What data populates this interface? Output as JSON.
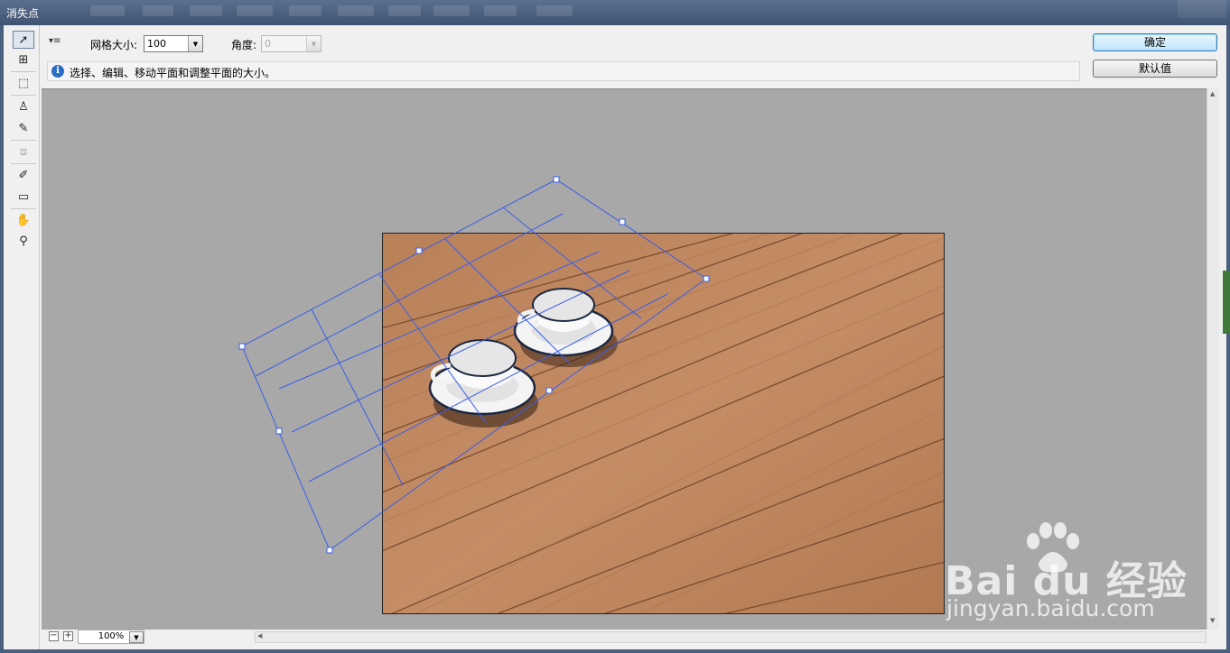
{
  "window": {
    "title": "消失点"
  },
  "tools": [
    {
      "name": "edit-plane-tool-icon",
      "glyph": "➚"
    },
    {
      "name": "create-plane-tool-icon",
      "glyph": "⊞"
    },
    {
      "name": "marquee-tool-icon",
      "glyph": "⬚"
    },
    {
      "name": "stamp-tool-icon",
      "glyph": "♙"
    },
    {
      "name": "brush-tool-icon",
      "glyph": "✎"
    },
    {
      "name": "transform-tool-icon",
      "glyph": "⧈"
    },
    {
      "name": "eyedropper-tool-icon",
      "glyph": "✐"
    },
    {
      "name": "measure-tool-icon",
      "glyph": "▭"
    },
    {
      "name": "hand-tool-icon",
      "glyph": "✋"
    },
    {
      "name": "zoom-tool-icon",
      "glyph": "⚲"
    }
  ],
  "options": {
    "menu_glyph": "▾≡",
    "grid_size_label": "网格大小:",
    "grid_size_value": "100",
    "angle_label": "角度:",
    "angle_value": "0"
  },
  "info": {
    "icon_glyph": "i",
    "text": "选择、编辑、移动平面和调整平面的大小。"
  },
  "buttons": {
    "ok": "确定",
    "default": "默认值"
  },
  "status": {
    "zoom_out": "−",
    "zoom_in": "+",
    "zoom": "100%"
  },
  "watermark": {
    "main": "Bai  du 经验",
    "sub": "jingyan.baidu.com"
  },
  "colors": {
    "grid_line": "#3a5ee8",
    "canvas_bg": "#a8a8a8",
    "wood": "#c08860"
  }
}
